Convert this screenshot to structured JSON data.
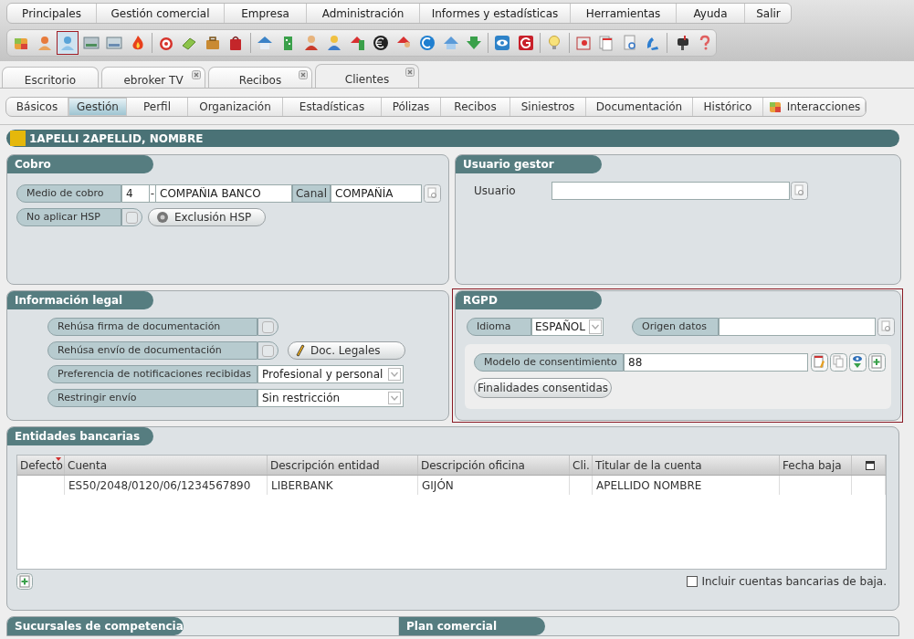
{
  "menu": [
    "Principales",
    "Gestión comercial",
    "Empresa",
    "Administración",
    "Informes y estadísticas",
    "Herramientas",
    "Ayuda",
    "Salir"
  ],
  "toolbar": [
    {
      "selected": false
    },
    {
      "selected": false
    },
    {
      "selected": true
    },
    {
      "selected": false
    },
    {
      "selected": false
    },
    {
      "selected": false
    },
    {
      "selected": false
    },
    {
      "selected": false
    },
    {
      "selected": false
    },
    {
      "selected": false
    },
    {
      "selected": false
    },
    {
      "selected": false
    },
    {
      "selected": false
    },
    {
      "selected": false
    },
    {
      "selected": false
    },
    {
      "selected": false
    },
    {
      "selected": false
    },
    {
      "selected": false
    },
    {
      "selected": false
    },
    {
      "selected": false
    },
    {
      "selected": false
    },
    {
      "selected": false
    },
    {
      "selected": false
    },
    {
      "selected": false
    },
    {
      "selected": false
    },
    {
      "selected": false
    },
    {
      "selected": false
    },
    {
      "selected": false
    },
    {
      "selected": false
    }
  ],
  "doc_tabs": [
    {
      "label": "Escritorio",
      "closable": false,
      "selected": false
    },
    {
      "label": "ebroker TV",
      "closable": true,
      "selected": false
    },
    {
      "label": "Recibos",
      "closable": true,
      "selected": false
    },
    {
      "label": "Clientes",
      "closable": true,
      "selected": true
    }
  ],
  "sub_tabs": [
    {
      "label": "Básicos",
      "kind": "plain",
      "selected": false
    },
    {
      "label": "Gestión",
      "kind": "plain",
      "selected": true
    },
    {
      "label": "Perfil",
      "kind": "plain",
      "selected": false
    },
    {
      "label": "Organización",
      "kind": "plain",
      "selected": false
    },
    {
      "label": "Estadísticas",
      "kind": "plain",
      "selected": false
    },
    {
      "label": "Pólizas",
      "kind": "plain",
      "selected": false
    },
    {
      "label": "Recibos",
      "kind": "plain",
      "selected": false
    },
    {
      "label": "Siniestros",
      "kind": "plain",
      "selected": false
    },
    {
      "label": "Documentación",
      "kind": "plain",
      "selected": false
    },
    {
      "label": "Histórico",
      "kind": "plain",
      "selected": false
    },
    {
      "label": "Interacciones",
      "kind": "icon",
      "selected": false
    }
  ],
  "client_header": {
    "name": "1APELLI 2APELLID, NOMBRE"
  },
  "cobro": {
    "title": "Cobro",
    "medio_label": "Medio de cobro",
    "medio_code": "4",
    "separator": "-",
    "medio_name": "COMPAÑIA BANCO",
    "canal_label": "Canal",
    "canal_value": "COMPAÑÍA",
    "hsp_label": "No aplicar HSP",
    "hsp_checked": false,
    "exclusion_button": "Exclusión HSP"
  },
  "usuario_gestor": {
    "title": "Usuario gestor",
    "usuario_label": "Usuario"
  },
  "informacion_legal": {
    "title": "Información legal",
    "rows": [
      {
        "kind": "checkbox",
        "label": "Rehúsa firma de documentación",
        "checked": false
      },
      {
        "kind": "checkbox",
        "label": "Rehúsa envío de documentación",
        "checked": false,
        "button": "Doc. Legales"
      },
      {
        "kind": "select",
        "label": "Preferencia de notificaciones recibidas",
        "value": "Profesional y personal"
      },
      {
        "kind": "select",
        "label": "Restringir envío",
        "value": "Sin restricción"
      }
    ]
  },
  "rgpd": {
    "title": "RGPD",
    "idioma_label": "Idioma",
    "idioma_value": "ESPAÑOL",
    "origen_label": "Origen datos",
    "modelo_label": "Modelo de consentimiento",
    "modelo_value": "88",
    "finalidades_button": "Finalidades consentidas"
  },
  "entidades_bancarias": {
    "title": "Entidades bancarias",
    "table": {
      "columns": [
        "Defecto",
        "Cuenta",
        "Descripción entidad",
        "Descripción oficina",
        "Cli.",
        "Titular de la cuenta",
        "Fecha baja"
      ],
      "rows": [
        [
          "",
          "ES50/2048/0120/06/1234567890",
          "LIBERBANK",
          "GIJÓN",
          "",
          "APELLIDO NOMBRE",
          ""
        ]
      ]
    },
    "include_checkbox": {
      "label": "Incluir cuentas bancarias de baja.",
      "checked": false
    }
  },
  "bottom_panels": [
    {
      "title": "Sucursales de competencia"
    },
    {
      "title": "Plan comercial"
    }
  ]
}
